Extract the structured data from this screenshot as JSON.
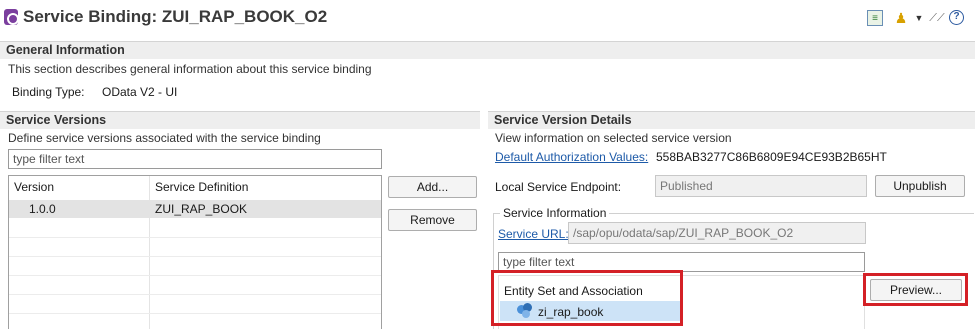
{
  "header": {
    "title": "Service Binding: ZUI_RAP_BOOK_O2",
    "icons": [
      "service-binding-icon",
      "document-icon",
      "person-icon",
      "dropdown-arrow-icon",
      "link-icon",
      "help-icon"
    ]
  },
  "general": {
    "section_title": "General Information",
    "description": "This section describes general information about this service binding",
    "binding_type_label": "Binding Type:",
    "binding_type_value": "OData V2 - UI"
  },
  "service_versions": {
    "section_title": "Service Versions",
    "description": "Define service versions associated with the service binding",
    "filter_placeholder": "type filter text",
    "columns": [
      "Version",
      "Service Definition"
    ],
    "rows": [
      {
        "version": "1.0.0",
        "definition": "ZUI_RAP_BOOK",
        "selected": true
      }
    ],
    "add_button": "Add...",
    "remove_button": "Remove"
  },
  "version_details": {
    "section_title": "Service Version Details",
    "description": "View information on selected service version",
    "auth_link": "Default Authorization Values:",
    "auth_value": "558BAB3277C86B6809E94CE93B2B65HT",
    "endpoint_label": "Local Service Endpoint:",
    "endpoint_value": "Published",
    "unpublish_button": "Unpublish",
    "service_info": {
      "group_title": "Service Information",
      "url_link": "Service URL:",
      "url_value": "/sap/opu/odata/sap/ZUI_RAP_BOOK_O2",
      "filter_placeholder": "type filter text",
      "entity_header": "Entity Set and Association",
      "entities": [
        "zi_rap_book"
      ],
      "preview_button": "Preview..."
    }
  },
  "colors": {
    "highlight_border": "#d42026",
    "link": "#1d5aa8",
    "section_bar": "#eeeeee"
  }
}
